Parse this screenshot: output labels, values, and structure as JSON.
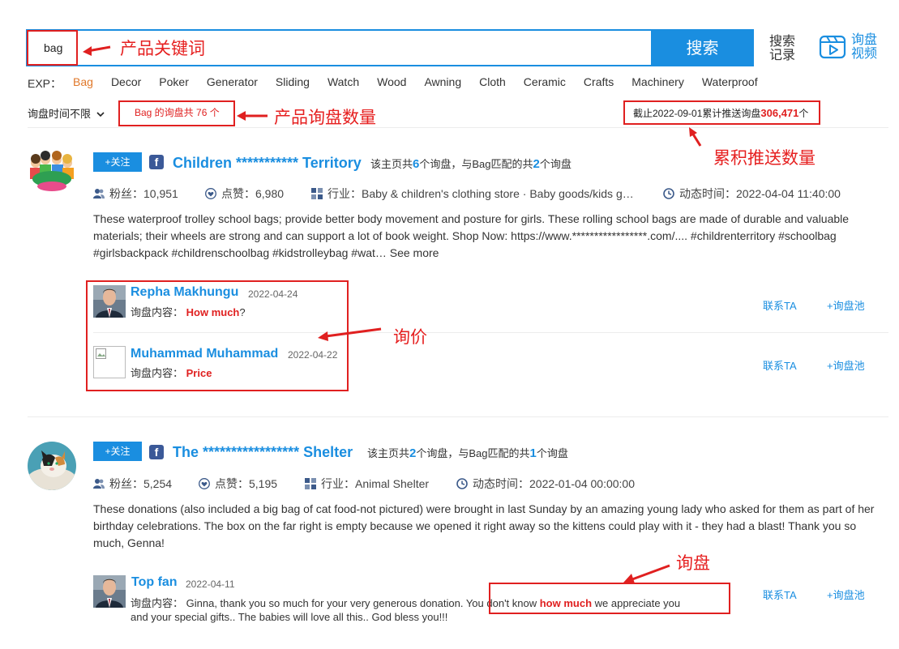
{
  "search": {
    "value": "bag",
    "button_label": "搜索",
    "history_label": "搜索记录",
    "video_label": "询盘视频"
  },
  "exp": {
    "label": "EXP：",
    "keywords": [
      "Bag",
      "Decor",
      "Poker",
      "Generator",
      "Sliding",
      "Watch",
      "Wood",
      "Awning",
      "Cloth",
      "Ceramic",
      "Crafts",
      "Machinery",
      "Waterproof"
    ],
    "active": "Bag"
  },
  "filter": {
    "time_label": "询盘时间不限"
  },
  "count": {
    "prefix": "Bag 的询盘共",
    "value": "76",
    "suffix": "个"
  },
  "total": {
    "prefix": "截止2022-09-01累计推送询盘",
    "value": "306,471",
    "suffix": "个"
  },
  "annotations": {
    "keyword": "产品关键词",
    "inquiry_count": "产品询盘数量",
    "total_push": "累积推送数量",
    "price_inquiry": "询价",
    "inquiry": "询盘"
  },
  "posts": [
    {
      "follow_label": "+关注",
      "page_name": "Children *********** Territory",
      "summary_a": "该主页共",
      "total_count": "6",
      "summary_b": "个询盘，与Bag匹配的共",
      "match_count": "2",
      "summary_c": "个询盘",
      "fans": "粉丝：10,951",
      "likes": "点赞：6,980",
      "industry": "行业：Baby & children's clothing store · Baby goods/kids g…",
      "time": "动态时间：2022-04-04 11:40:00",
      "description": "These waterproof trolley school bags; provide better body movement and posture for girls. These rolling school bags are made of durable and valuable materials; their wheels are strong and can support a lot of book weight. Shop Now: https://www.*****************.com/.... #childrenterritory #schoolbag #girlsbackpack #childrenschoolbag #kidstrolleybag #wat… See more",
      "inquiries": [
        {
          "name": "Repha Makhungu",
          "date": "2022-04-24",
          "content_label": "询盘内容：",
          "highlight": "How much",
          "rest": "?"
        },
        {
          "name": "Muhammad Muhammad",
          "date": "2022-04-22",
          "content_label": "询盘内容：",
          "highlight": "Price",
          "rest": ""
        }
      ]
    },
    {
      "follow_label": "+关注",
      "page_name": "The ***************** Shelter",
      "summary_a": "该主页共",
      "total_count": "2",
      "summary_b": "个询盘，与Bag匹配的共",
      "match_count": "1",
      "summary_c": "个询盘",
      "fans": "粉丝：5,254",
      "likes": "点赞：5,195",
      "industry": "行业：Animal Shelter",
      "time": "动态时间：2022-01-04 00:00:00",
      "description": "These donations (also included a big bag of cat food-not pictured) were brought in last Sunday by an amazing young lady who asked for them as part of her birthday celebrations. The box on the far right is empty because we opened it right away so the kittens could play with it - they had a blast! Thank you so much, Genna!",
      "inquiries": [
        {
          "name": "Top fan",
          "date": "2022-04-11",
          "content_label": "询盘内容：",
          "text_a": "Ginna, thank you so much for your very generous donation. You don't know ",
          "highlight": "how much",
          "text_b": " we appreciate you",
          "text_c": "and your special gifts.. The babies will love all this.. God bless you!!!"
        }
      ]
    }
  ],
  "actions": {
    "contact": "联系TA",
    "add_pool": "+询盘池"
  }
}
